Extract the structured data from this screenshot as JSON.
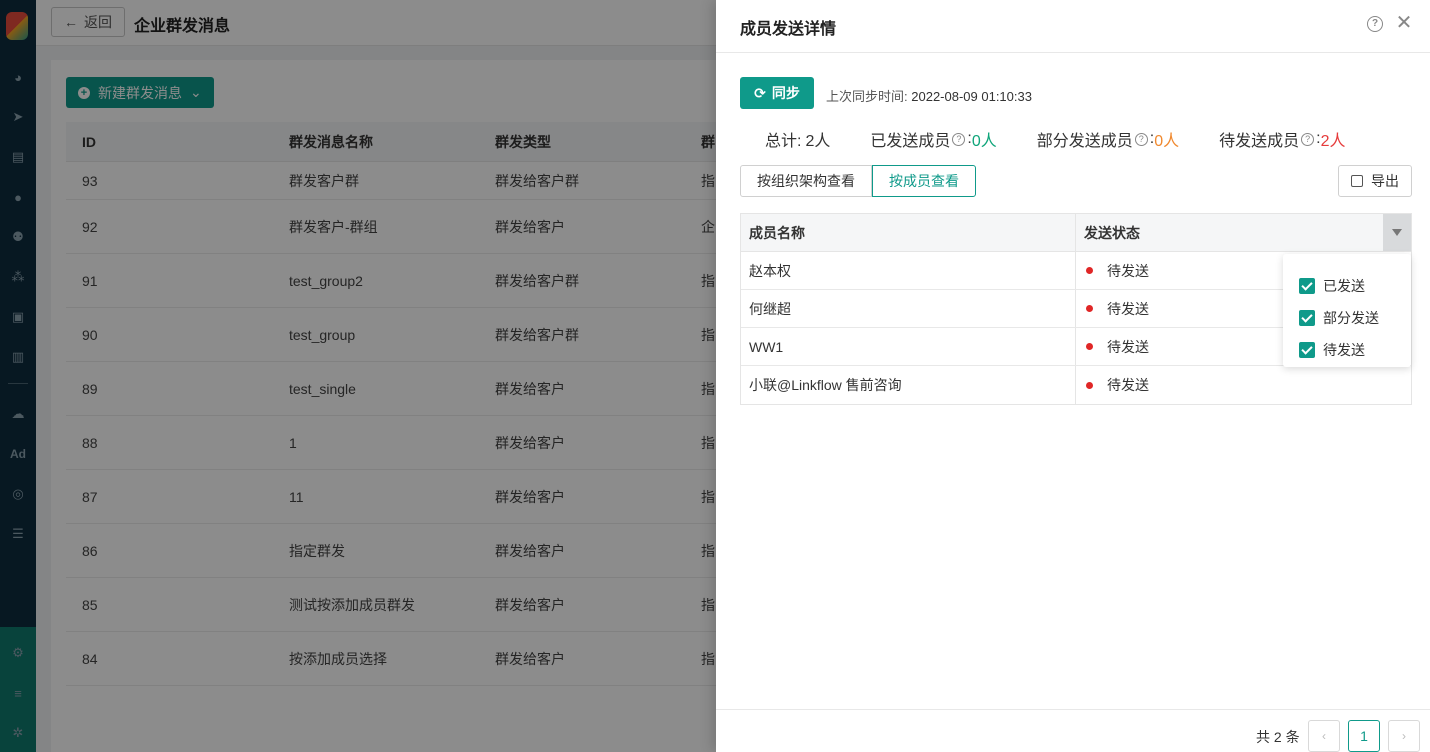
{
  "sidebar": {
    "icons": [
      "dashboard-icon",
      "send-icon",
      "layout-icon",
      "user-icon",
      "users-icon",
      "org-icon",
      "bookmark-icon",
      "chart-icon",
      "wechat-icon",
      "ad-icon",
      "target-icon",
      "list-icon",
      "support-icon",
      "server-icon",
      "settings-icon"
    ],
    "ad_label": "Ad"
  },
  "topbar": {
    "back_label": "返回",
    "title": "企业群发消息"
  },
  "main": {
    "new_button": "新建群发消息",
    "columns": [
      "ID",
      "群发消息名称",
      "群发类型",
      "群"
    ],
    "rows": [
      {
        "id": "93",
        "name": "群发客户群",
        "type": "群发给客户群",
        "extra": "指"
      },
      {
        "id": "92",
        "name": "群发客户-群组",
        "type": "群发给客户",
        "extra": "企"
      },
      {
        "id": "91",
        "name": "test_group2",
        "type": "群发给客户群",
        "extra": "指"
      },
      {
        "id": "90",
        "name": "test_group",
        "type": "群发给客户群",
        "extra": "指"
      },
      {
        "id": "89",
        "name": "test_single",
        "type": "群发给客户",
        "extra": "指"
      },
      {
        "id": "88",
        "name": "1",
        "type": "群发给客户",
        "extra": "指"
      },
      {
        "id": "87",
        "name": "11",
        "type": "群发给客户",
        "extra": "指"
      },
      {
        "id": "86",
        "name": "指定群发",
        "type": "群发给客户",
        "extra": "指"
      },
      {
        "id": "85",
        "name": "测试按添加成员群发",
        "type": "群发给客户",
        "extra": "指"
      },
      {
        "id": "84",
        "name": "按添加成员选择",
        "type": "群发给客户",
        "extra": "指"
      }
    ]
  },
  "drawer": {
    "title": "成员发送详情",
    "sync_button": "同步",
    "sync_label": "上次同步时间:",
    "sync_time": "2022-08-09 01:10:33",
    "stats": {
      "total_label": "总计:",
      "total_value": "2人",
      "sent_label": "已发送成员",
      "sent_value": "0人",
      "partial_label": "部分发送成员",
      "partial_value": "0人",
      "pending_label": "待发送成员",
      "pending_value": "2人",
      "colon": ":"
    },
    "tabs": [
      "按组织架构查看",
      "按成员查看"
    ],
    "export_button": "导出",
    "table": {
      "columns": [
        "成员名称",
        "发送状态"
      ],
      "rows": [
        {
          "name": "赵本权",
          "status": "待发送"
        },
        {
          "name": "何继超",
          "status": "待发送"
        },
        {
          "name": "WW1",
          "status": "待发送"
        },
        {
          "name": "小联@Linkflow 售前咨询",
          "status": "待发送"
        }
      ]
    },
    "filter_options": [
      "已发送",
      "部分发送",
      "待发送"
    ],
    "pagination": {
      "total": "共 2 条",
      "current_page": "1",
      "prev": "‹",
      "next": "›"
    },
    "status_color": "#e02626",
    "accent_color": "#0f9a8a"
  }
}
